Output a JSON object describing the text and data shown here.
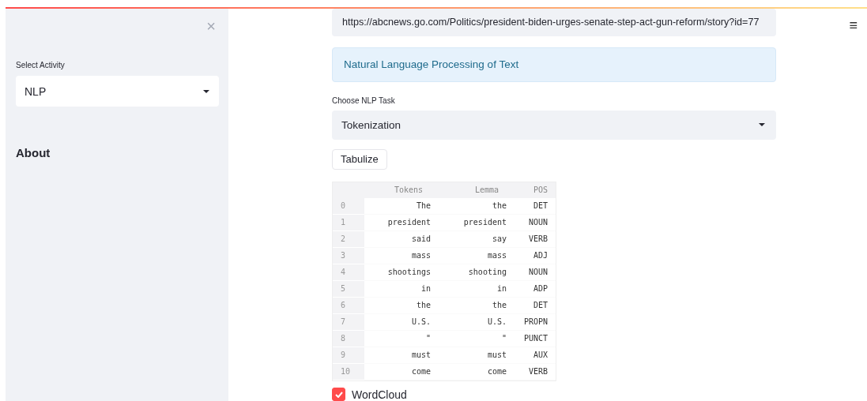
{
  "sidebar": {
    "close_icon": "×",
    "select": {
      "label": "Select Activity",
      "value": "NLP"
    },
    "heading": "About"
  },
  "menu_icon": "≡",
  "url_field": {
    "value": "https://abcnews.go.com/Politics/president-biden-urges-senate-step-act-gun-reform/story?id=77"
  },
  "info": "Natural Language Processing of Text",
  "task_select": {
    "label": "Choose NLP Task",
    "value": "Tokenization"
  },
  "tabulize_button": "Tabulize",
  "table": {
    "columns": [
      "Tokens",
      "Lemma",
      "POS"
    ],
    "rows": [
      {
        "index": "0",
        "cells": [
          "The",
          "the",
          "DET"
        ]
      },
      {
        "index": "1",
        "cells": [
          "president",
          "president",
          "NOUN"
        ]
      },
      {
        "index": "2",
        "cells": [
          "said",
          "say",
          "VERB"
        ]
      },
      {
        "index": "3",
        "cells": [
          "mass",
          "mass",
          "ADJ"
        ]
      },
      {
        "index": "4",
        "cells": [
          "shootings",
          "shooting",
          "NOUN"
        ]
      },
      {
        "index": "5",
        "cells": [
          "in",
          "in",
          "ADP"
        ]
      },
      {
        "index": "6",
        "cells": [
          "the",
          "the",
          "DET"
        ]
      },
      {
        "index": "7",
        "cells": [
          "U.S.",
          "U.S.",
          "PROPN"
        ]
      },
      {
        "index": "8",
        "cells": [
          "\"",
          "\"",
          "PUNCT"
        ]
      },
      {
        "index": "9",
        "cells": [
          "must",
          "must",
          "AUX"
        ]
      },
      {
        "index": "10",
        "cells": [
          "come",
          "come",
          "VERB"
        ]
      }
    ]
  },
  "wordcloud": {
    "label": "WordCloud",
    "checked": true
  }
}
